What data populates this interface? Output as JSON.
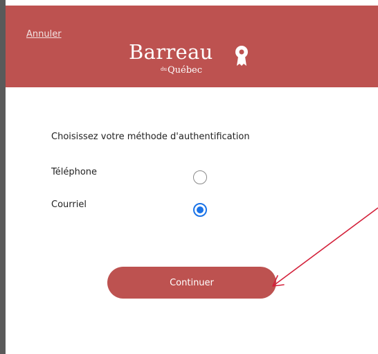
{
  "header": {
    "cancel_label": "Annuler",
    "logo_name": "Barreau",
    "logo_sub_prefix": "du",
    "logo_sub": "Québec",
    "emblem_icon": "barreau-seal-icon",
    "background_color": "#bd5250"
  },
  "form": {
    "prompt": "Choisissez votre méthode d'authentification",
    "options": [
      {
        "label": "Téléphone",
        "checked": false
      },
      {
        "label": "Courriel",
        "checked": true
      }
    ],
    "continue_label": "Continuer",
    "accent_color": "#1a73e8"
  },
  "annotation": {
    "arrow_color": "#d3213a"
  }
}
